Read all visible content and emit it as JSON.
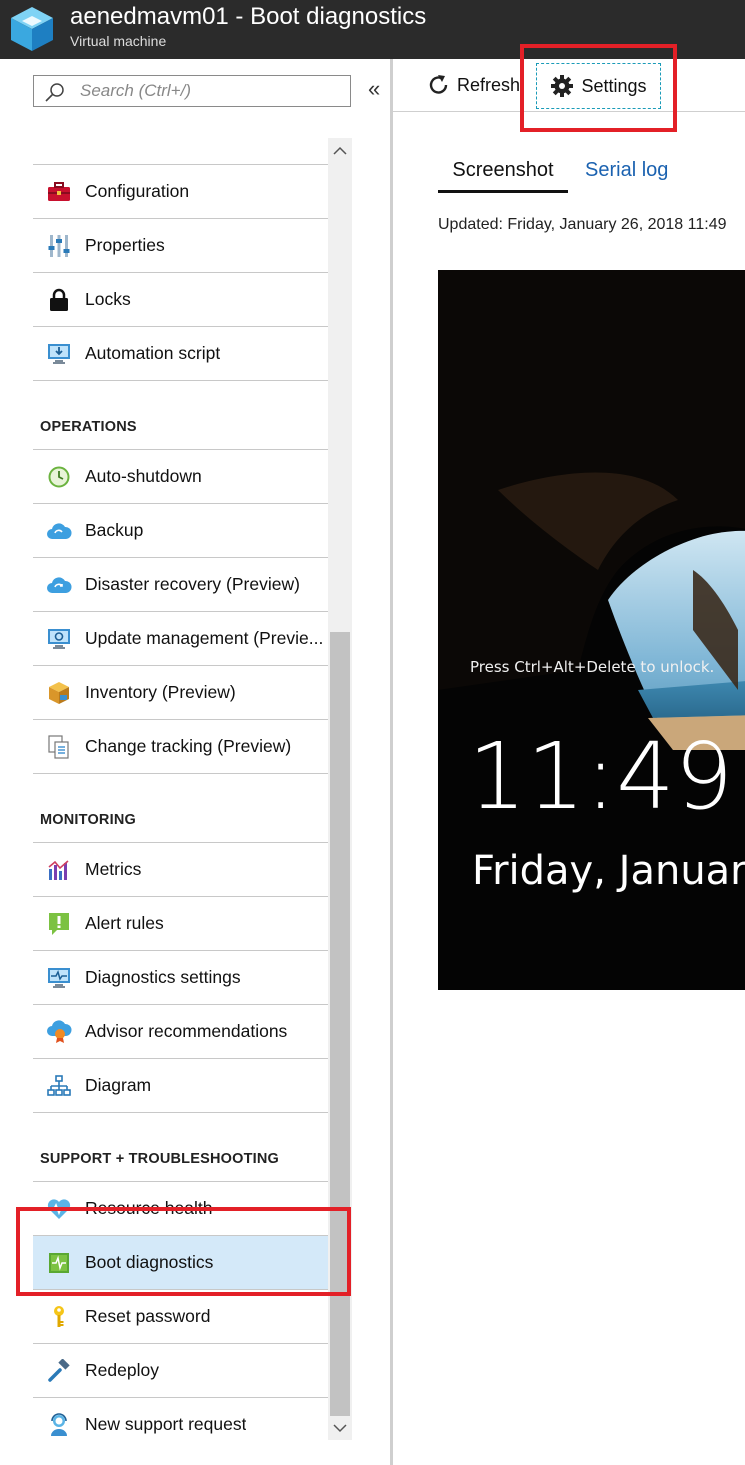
{
  "header": {
    "title": "aenedmavm01 - Boot diagnostics",
    "subtitle": "Virtual machine"
  },
  "search": {
    "placeholder": "Search (Ctrl+/)"
  },
  "menu": {
    "items_settings": [
      {
        "label": "Configuration",
        "icon": "toolbox-icon"
      },
      {
        "label": "Properties",
        "icon": "sliders-icon"
      },
      {
        "label": "Locks",
        "icon": "lock-icon"
      },
      {
        "label": "Automation script",
        "icon": "download-monitor-icon"
      }
    ],
    "operations_header": "OPERATIONS",
    "items_operations": [
      {
        "label": "Auto-shutdown",
        "icon": "clock-icon"
      },
      {
        "label": "Backup",
        "icon": "cloud-backup-icon"
      },
      {
        "label": "Disaster recovery (Preview)",
        "icon": "cloud-recovery-icon"
      },
      {
        "label": "Update management (Previe...",
        "icon": "update-monitor-icon"
      },
      {
        "label": "Inventory (Preview)",
        "icon": "boxes-icon"
      },
      {
        "label": "Change tracking (Preview)",
        "icon": "documents-icon"
      }
    ],
    "monitoring_header": "MONITORING",
    "items_monitoring": [
      {
        "label": "Metrics",
        "icon": "bar-chart-icon"
      },
      {
        "label": "Alert rules",
        "icon": "alert-icon"
      },
      {
        "label": "Diagnostics settings",
        "icon": "pulse-monitor-icon"
      },
      {
        "label": "Advisor recommendations",
        "icon": "advisor-cloud-icon"
      },
      {
        "label": "Diagram",
        "icon": "hierarchy-icon"
      }
    ],
    "support_header": "SUPPORT + TROUBLESHOOTING",
    "items_support": [
      {
        "label": "Resource health",
        "icon": "heart-pulse-icon"
      },
      {
        "label": "Boot diagnostics",
        "icon": "boot-diagnostics-icon",
        "selected": true
      },
      {
        "label": "Reset password",
        "icon": "key-icon"
      },
      {
        "label": "Redeploy",
        "icon": "hammer-icon"
      },
      {
        "label": "New support request",
        "icon": "support-person-icon"
      }
    ]
  },
  "toolbar": {
    "refresh_label": "Refresh",
    "settings_label": "Settings"
  },
  "tabs": {
    "screenshot": "Screenshot",
    "serial_log": "Serial log"
  },
  "updated_text": "Updated: Friday, January 26, 2018 11:49",
  "boot_screen": {
    "unlock_text": "Press Ctrl+Alt+Delete to unlock.",
    "time": "11:49",
    "date": "Friday, January"
  },
  "colors": {
    "header_bg": "#2b2b2b",
    "selected_bg": "#d4e9f9",
    "highlight_red": "#e32027",
    "link_blue": "#1b62b0"
  }
}
